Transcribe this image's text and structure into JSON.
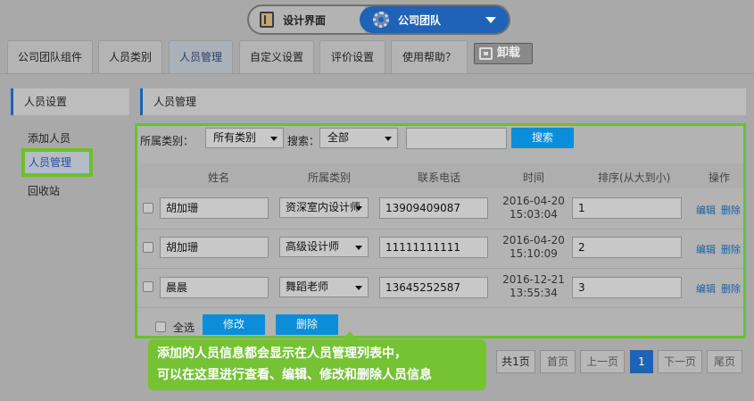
{
  "switcher": {
    "left_label": "设计界面",
    "right_label": "公司团队"
  },
  "tabs": [
    {
      "label": "公司团队组件"
    },
    {
      "label": "人员类别"
    },
    {
      "label": "人员管理"
    },
    {
      "label": "自定义设置"
    },
    {
      "label": "评价设置"
    },
    {
      "label": "使用帮助？"
    }
  ],
  "uninstall_label": "卸载",
  "sidebar": {
    "title": "人员设置",
    "items": [
      {
        "label": "添加人员"
      },
      {
        "label": "人员管理"
      },
      {
        "label": "回收站"
      }
    ]
  },
  "main": {
    "title": "人员管理",
    "filter": {
      "category_label": "所属类别：",
      "category_value": "所有类别",
      "search_label": "搜索：",
      "search_value": "全部",
      "search_text": "",
      "search_button": "搜索"
    },
    "columns": [
      "姓名",
      "所属类别",
      "联系电话",
      "时间",
      "排序(从大到小)",
      "操作"
    ],
    "rows": [
      {
        "name": "胡加珊",
        "category": "资深室内设计师",
        "phone": "13909409087",
        "date": "2016-04-20",
        "time": "15:03:04",
        "order": "1"
      },
      {
        "name": "胡加珊",
        "category": "高级设计师",
        "phone": "11111111111",
        "date": "2016-04-20",
        "time": "15:10:09",
        "order": "2"
      },
      {
        "name": "晨晨",
        "category": "舞蹈老师",
        "phone": "13645252587",
        "date": "2016-12-21",
        "time": "13:55:34",
        "order": "3"
      }
    ],
    "edit_label": "编辑",
    "delete_label": "删除",
    "select_all_label": "全选",
    "modify_button": "修改",
    "delete_button": "删除"
  },
  "callout": {
    "line1": "添加的人员信息都会显示在人员管理列表中，",
    "line2": "可以在这里进行查看、编辑、修改和删除人员信息"
  },
  "pagination": {
    "total": "共1页",
    "first": "首页",
    "prev": "上一页",
    "current": "1",
    "next": "下一页",
    "last": "尾页"
  }
}
